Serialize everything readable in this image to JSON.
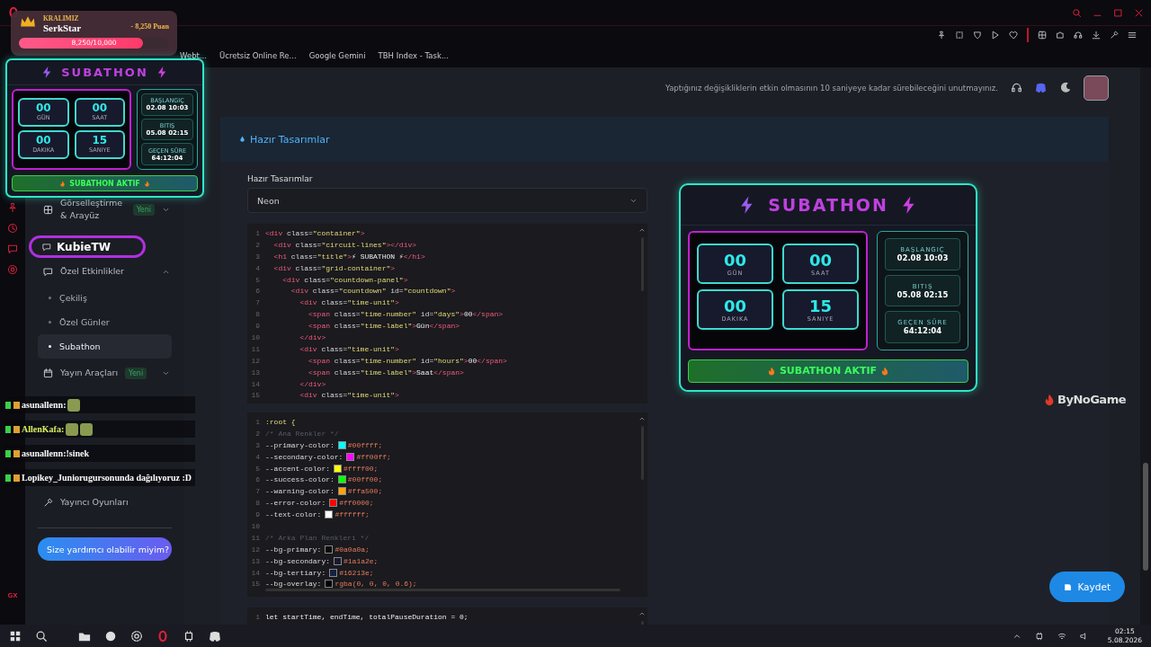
{
  "browser": {
    "logo": "GX",
    "bookmarks": [
      {
        "label": "Webt..."
      },
      {
        "label": "Ücretsiz Online Re..."
      },
      {
        "label": "Google Gemini"
      },
      {
        "label": "TBH Index - Task..."
      }
    ]
  },
  "header": {
    "notice": "Yaptığınız değişikliklerin etkin olmasının 10 saniyeye kadar sürebileceğini unutmayınız."
  },
  "sidebar": {
    "items": [
      {
        "label": "Görselleştirme & Arayüz",
        "badge": "Yeni",
        "expanded": false
      },
      {
        "label": "Özel Etkinlikler",
        "expanded": true,
        "children": [
          {
            "label": "Çekiliş",
            "selected": false
          },
          {
            "label": "Özel Günler",
            "selected": false
          },
          {
            "label": "Subathon",
            "selected": true
          }
        ]
      },
      {
        "label": "Yayın Araçları",
        "badge": "Yeni",
        "expanded": false
      },
      {
        "label": "Yayıncı Oyunları"
      }
    ],
    "help_button": "Size yardımcı olabilir miyim?"
  },
  "panel": {
    "title": "Hazır Tasarımlar",
    "field_label": "Hazır Tasarımlar",
    "select_value": "Neon",
    "html_code": [
      {
        "number": "1",
        "tokens": [
          {
            "kind": "tag",
            "text": "<div"
          },
          {
            "kind": "attr",
            "text": " class="
          },
          {
            "kind": "string",
            "text": "\"container\""
          },
          {
            "kind": "tag",
            "text": ">"
          }
        ]
      },
      {
        "number": "2",
        "tokens": [
          {
            "kind": "tag",
            "text": "  <div"
          },
          {
            "kind": "attr",
            "text": " class="
          },
          {
            "kind": "string",
            "text": "\"circuit-lines\""
          },
          {
            "kind": "tag",
            "text": "></div>"
          }
        ]
      },
      {
        "number": "3",
        "tokens": [
          {
            "kind": "tag",
            "text": "  <h1"
          },
          {
            "kind": "attr",
            "text": " class="
          },
          {
            "kind": "string",
            "text": "\"title\""
          },
          {
            "kind": "tag",
            "text": ">"
          },
          {
            "kind": "text",
            "text": "⚡ SUBATHON ⚡"
          },
          {
            "kind": "tag",
            "text": "</h1>"
          }
        ]
      },
      {
        "number": "4",
        "tokens": [
          {
            "kind": "tag",
            "text": "  <div"
          },
          {
            "kind": "attr",
            "text": " class="
          },
          {
            "kind": "string",
            "text": "\"grid-container\""
          },
          {
            "kind": "tag",
            "text": ">"
          }
        ]
      },
      {
        "number": "5",
        "tokens": [
          {
            "kind": "tag",
            "text": "    <div"
          },
          {
            "kind": "attr",
            "text": " class="
          },
          {
            "kind": "string",
            "text": "\"countdown-panel\""
          },
          {
            "kind": "tag",
            "text": ">"
          }
        ]
      },
      {
        "number": "6",
        "tokens": [
          {
            "kind": "tag",
            "text": "      <div"
          },
          {
            "kind": "attr",
            "text": " class="
          },
          {
            "kind": "string",
            "text": "\"countdown\""
          },
          {
            "kind": "attr",
            "text": " id="
          },
          {
            "kind": "string",
            "text": "\"countdown\""
          },
          {
            "kind": "tag",
            "text": ">"
          }
        ]
      },
      {
        "number": "7",
        "tokens": [
          {
            "kind": "tag",
            "text": "        <div"
          },
          {
            "kind": "attr",
            "text": " class="
          },
          {
            "kind": "string",
            "text": "\"time-unit\""
          },
          {
            "kind": "tag",
            "text": ">"
          }
        ]
      },
      {
        "number": "8",
        "tokens": [
          {
            "kind": "tag",
            "text": "          <span"
          },
          {
            "kind": "attr",
            "text": " class="
          },
          {
            "kind": "string",
            "text": "\"time-number\""
          },
          {
            "kind": "attr",
            "text": " id="
          },
          {
            "kind": "string",
            "text": "\"days\""
          },
          {
            "kind": "tag",
            "text": ">"
          },
          {
            "kind": "text",
            "text": "00"
          },
          {
            "kind": "tag",
            "text": "</span>"
          }
        ]
      },
      {
        "number": "9",
        "tokens": [
          {
            "kind": "tag",
            "text": "          <span"
          },
          {
            "kind": "attr",
            "text": " class="
          },
          {
            "kind": "string",
            "text": "\"time-label\""
          },
          {
            "kind": "tag",
            "text": ">"
          },
          {
            "kind": "text",
            "text": "Gün"
          },
          {
            "kind": "tag",
            "text": "</span>"
          }
        ]
      },
      {
        "number": "10",
        "tokens": [
          {
            "kind": "tag",
            "text": "        </div>"
          }
        ]
      },
      {
        "number": "11",
        "tokens": [
          {
            "kind": "tag",
            "text": "        <div"
          },
          {
            "kind": "attr",
            "text": " class="
          },
          {
            "kind": "string",
            "text": "\"time-unit\""
          },
          {
            "kind": "tag",
            "text": ">"
          }
        ]
      },
      {
        "number": "12",
        "tokens": [
          {
            "kind": "tag",
            "text": "          <span"
          },
          {
            "kind": "attr",
            "text": " class="
          },
          {
            "kind": "string",
            "text": "\"time-number\""
          },
          {
            "kind": "attr",
            "text": " id="
          },
          {
            "kind": "string",
            "text": "\"hours\""
          },
          {
            "kind": "tag",
            "text": ">"
          },
          {
            "kind": "text",
            "text": "00"
          },
          {
            "kind": "tag",
            "text": "</span>"
          }
        ]
      },
      {
        "number": "13",
        "tokens": [
          {
            "kind": "tag",
            "text": "          <span"
          },
          {
            "kind": "attr",
            "text": " class="
          },
          {
            "kind": "string",
            "text": "\"time-label\""
          },
          {
            "kind": "tag",
            "text": ">"
          },
          {
            "kind": "text",
            "text": "Saat"
          },
          {
            "kind": "tag",
            "text": "</span>"
          }
        ]
      },
      {
        "number": "14",
        "tokens": [
          {
            "kind": "tag",
            "text": "        </div>"
          }
        ]
      },
      {
        "number": "15",
        "tokens": [
          {
            "kind": "tag",
            "text": "        <div"
          },
          {
            "kind": "attr",
            "text": " class="
          },
          {
            "kind": "string",
            "text": "\"time-unit\""
          },
          {
            "kind": "tag",
            "text": ">"
          }
        ]
      }
    ],
    "css_code": [
      {
        "number": "1",
        "kind": "selector",
        "text": ":root {"
      },
      {
        "number": "2",
        "kind": "comment",
        "text": "/* Ana Renkler */"
      },
      {
        "number": "3",
        "kind": "declaration",
        "property": "--primary-color:",
        "color": "#00ffff",
        "value": "#00ffff;"
      },
      {
        "number": "4",
        "kind": "declaration",
        "property": "--secondary-color:",
        "color": "#ff00ff",
        "value": "#ff00ff;"
      },
      {
        "number": "5",
        "kind": "declaration",
        "property": "--accent-color:",
        "color": "#ffff00",
        "value": "#ffff00;"
      },
      {
        "number": "6",
        "kind": "declaration",
        "property": "--success-color:",
        "color": "#00ff00",
        "value": "#00ff00;"
      },
      {
        "number": "7",
        "kind": "declaration",
        "property": "--warning-color:",
        "color": "#ffa500",
        "value": "#ffa500;"
      },
      {
        "number": "8",
        "kind": "declaration",
        "property": "--error-color:",
        "color": "#ff0000",
        "value": "#ff0000;"
      },
      {
        "number": "9",
        "kind": "declaration",
        "property": "--text-color:",
        "color": "#ffffff",
        "value": "#ffffff;"
      },
      {
        "number": "10",
        "kind": "blank"
      },
      {
        "number": "11",
        "kind": "comment",
        "text": "/* Arka Plan Renkleri */"
      },
      {
        "number": "12",
        "kind": "declaration",
        "property": "--bg-primary:",
        "color": "#0a0a0a",
        "value": "#0a0a0a;"
      },
      {
        "number": "13",
        "kind": "declaration",
        "property": "--bg-secondary:",
        "color": "#1a1a2e",
        "value": "#1a1a2e;"
      },
      {
        "number": "14",
        "kind": "declaration",
        "property": "--bg-tertiary:",
        "color": "#16213e",
        "value": "#16213e;"
      },
      {
        "number": "15",
        "kind": "declaration",
        "property": "--bg-overlay:",
        "color": "#000000",
        "value": "rgba(0, 0, 0, 0.6);"
      }
    ],
    "js_code": [
      {
        "number": "1",
        "text": "let startTime, endTime, totalPauseDuration = 0;"
      }
    ]
  },
  "preview": {
    "title": "SUBATHON",
    "units": [
      {
        "value": "00",
        "label": "GÜN"
      },
      {
        "value": "00",
        "label": "SAAT"
      },
      {
        "value": "00",
        "label": "DAKIKA"
      },
      {
        "value": "15",
        "label": "SANIYE"
      }
    ],
    "info": [
      {
        "label": "BAŞLANGIÇ",
        "value": "02.08 10:03"
      },
      {
        "label": "BITIŞ",
        "value": "05.08 02:15"
      },
      {
        "label": "GEÇEN SÜRE",
        "value": "64:12:04"
      }
    ],
    "status": "SUBATHON AKTIF"
  },
  "save_button": "Kaydet",
  "overlay": {
    "leader": {
      "caption": "KRALIMIZ",
      "name": "SerkStar",
      "points": "- 8,250 Puan",
      "progress": "8,250/10,000",
      "level": 0.825
    },
    "widget": {
      "title": "SUBATHON",
      "units": [
        {
          "value": "00",
          "label": "GÜN"
        },
        {
          "value": "00",
          "label": "SAAT"
        },
        {
          "value": "00",
          "label": "DAKIKA"
        },
        {
          "value": "15",
          "label": "SANIYE"
        }
      ],
      "info": [
        {
          "label": "BAŞLANGIÇ",
          "value": "02.08 10:03"
        },
        {
          "label": "BITIŞ",
          "value": "05.08 02:15"
        },
        {
          "label": "GEÇEN SÜRE",
          "value": "64:12:04"
        }
      ],
      "status": "SUBATHON AKTIF"
    },
    "streamer_badge": "KubieTW",
    "chat": [
      {
        "user": "asunallenn:",
        "color": "#ffffff",
        "parts": [
          {
            "kind": "emote"
          }
        ]
      },
      {
        "user": "AllenKafa:",
        "color": "#d8f060",
        "parts": [
          {
            "kind": "emote"
          },
          {
            "kind": "emote"
          }
        ]
      },
      {
        "user": "asunallenn:",
        "color": "#ffffff",
        "parts": [
          {
            "kind": "text",
            "text": "!sinek"
          }
        ]
      },
      {
        "user": "Lopikey_Juniorugur",
        "color": "#ffffff",
        "parts": [
          {
            "kind": "text",
            "text": "sonunda dağılıyoruz :D"
          }
        ]
      }
    ],
    "sponsor": "ByNoGame"
  },
  "taskbar": {
    "time": "02:15",
    "date": "5.08.2026"
  }
}
